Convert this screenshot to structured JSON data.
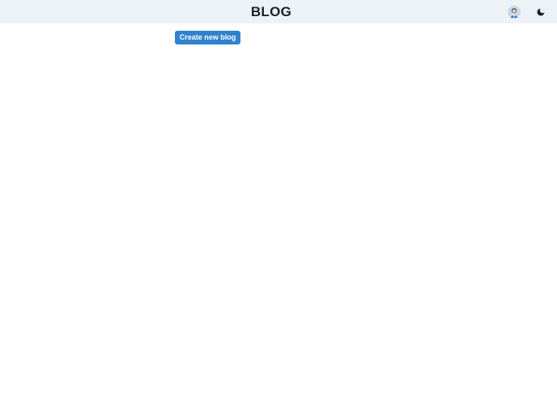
{
  "header": {
    "brand": "BLOG",
    "background": "#edf2f7",
    "avatar_icon": "user-avatar-icon",
    "theme_icon": "moon-icon"
  },
  "main": {
    "create_label": "Create new blog",
    "accent": "#3182ce"
  }
}
